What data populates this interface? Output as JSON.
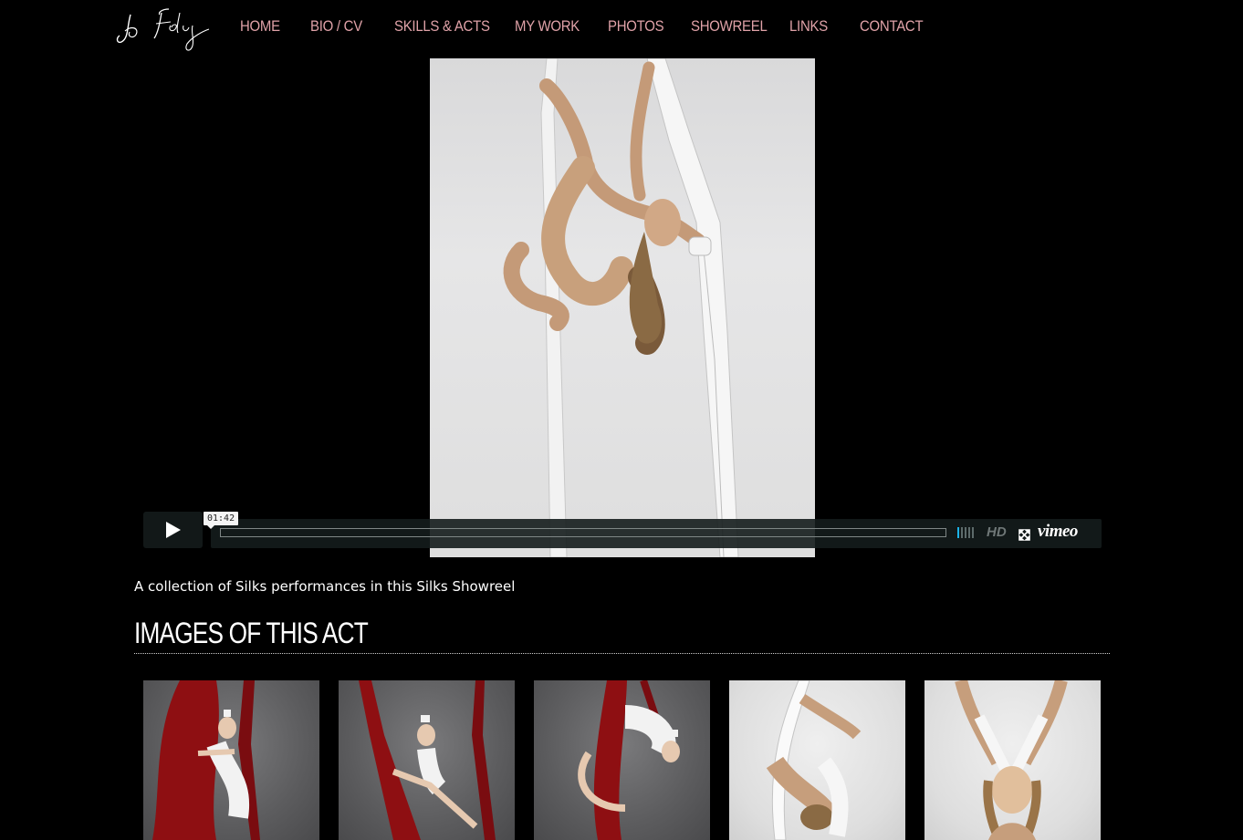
{
  "brand": {
    "logo_text": "Jo Foley"
  },
  "nav": [
    {
      "label": "HOME"
    },
    {
      "label": "BIO / CV"
    },
    {
      "label": "SKILLS & ACTS"
    },
    {
      "label": "MY WORK"
    },
    {
      "label": "PHOTOS"
    },
    {
      "label": "SHOWREEL"
    },
    {
      "label": "LINKS"
    },
    {
      "label": "CONTACT"
    }
  ],
  "colors": {
    "nav_link": "#e0a2a8",
    "background": "#000000",
    "volume_active": "#1bb3e8"
  },
  "video": {
    "time_tooltip": "01:42",
    "play_icon": "play-icon",
    "hd_label": "HD",
    "provider_logo": "vimeo",
    "volume_level": 0.2
  },
  "caption": "A collection of Silks performances in this Silks Showreel",
  "section_title": "IMAGES OF THIS ACT",
  "gallery": [
    {
      "photo": "red-silks-straddle"
    },
    {
      "photo": "red-silks-split"
    },
    {
      "photo": "red-silks-inverted"
    },
    {
      "photo": "white-silks-contortion"
    },
    {
      "photo": "white-silks-portrait"
    }
  ]
}
